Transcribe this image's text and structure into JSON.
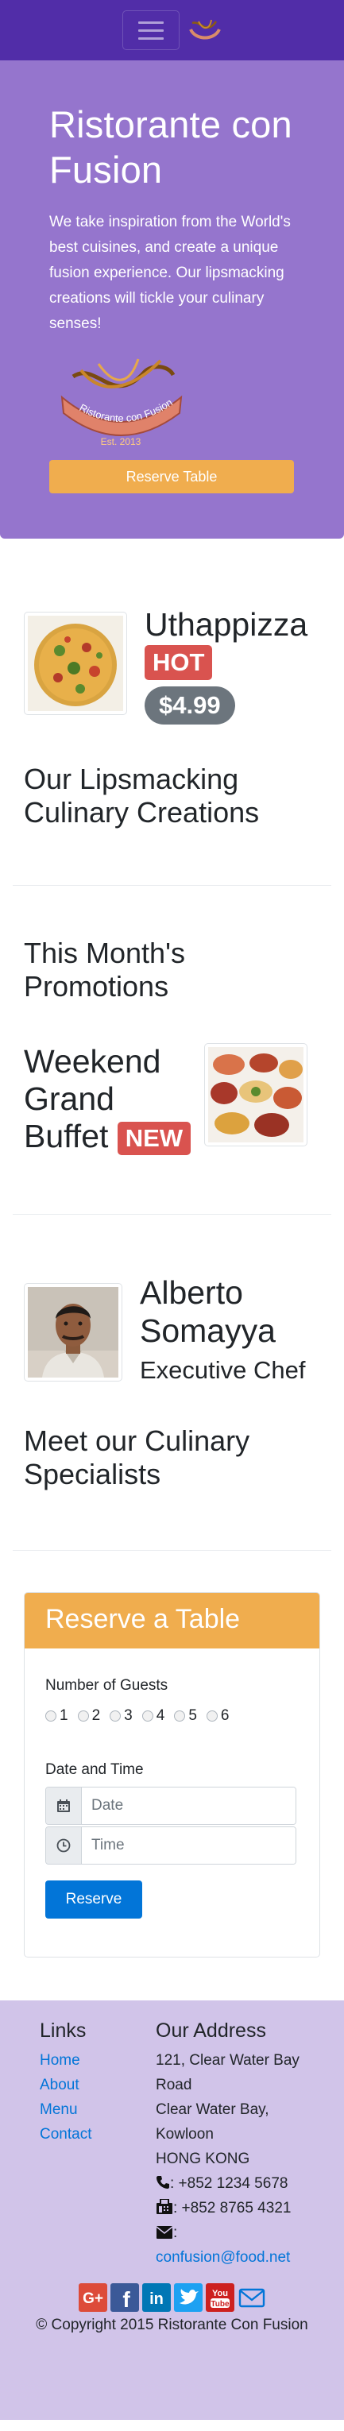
{
  "jumbotron": {
    "title": "Ristorante con Fusion",
    "text": "We take inspiration from the World's best cuisines, and create a unique fusion experience. Our lipsmacking creations will tickle your culinary senses!",
    "logo_text": "Ristorante con Fusion",
    "logo_year": "Est. 2013",
    "reserve_label": "Reserve Table"
  },
  "dish": {
    "name": "Uthappizza",
    "badge": "HOT",
    "price": "$4.99",
    "caption": "Our Lipsmacking Culinary Creations"
  },
  "promotion": {
    "heading": "This Month's Promotions",
    "name": "Weekend Grand Buffet",
    "badge": "NEW"
  },
  "leader": {
    "name": "Alberto Somayya",
    "designation": "Executive Chef",
    "caption": "Meet our Culinary Specialists"
  },
  "reservation": {
    "title": "Reserve a Table",
    "guests_label": "Number of Guests",
    "guest_options": [
      "1",
      "2",
      "3",
      "4",
      "5",
      "6"
    ],
    "datetime_label": "Date and Time",
    "date_placeholder": "Date",
    "time_placeholder": "Time",
    "submit_label": "Reserve"
  },
  "footer": {
    "links_title": "Links",
    "links": [
      "Home",
      "About",
      "Menu",
      "Contact"
    ],
    "address_title": "Our Address",
    "address_lines": [
      "121, Clear Water Bay Road",
      "Clear Water Bay, Kowloon",
      "HONG KONG"
    ],
    "phone": ": +852 1234 5678",
    "fax": ": +852 8765 4321",
    "email_prefix": ":",
    "email": "confusion@food.net",
    "copyright": "© Copyright 2015 Ristorante Con Fusion"
  },
  "colors": {
    "primary_dark": "#512DA8",
    "primary": "#9575CD",
    "primary_light": "#D1C4E9",
    "warning": "#f0ad4e",
    "danger": "#d9534f",
    "secondary": "#6c757d",
    "link": "#0275d8"
  },
  "icons": [
    "hamburger-icon",
    "logo-icon",
    "calendar-icon",
    "clock-icon",
    "phone-icon",
    "fax-icon",
    "envelope-icon",
    "google-plus-icon",
    "facebook-icon",
    "linkedin-icon",
    "twitter-icon",
    "youtube-icon",
    "mail-icon"
  ]
}
